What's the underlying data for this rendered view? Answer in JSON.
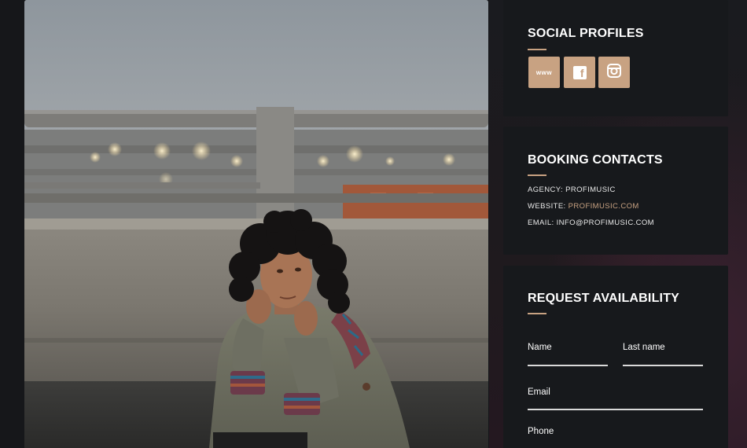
{
  "social": {
    "title": "SOCIAL PROFILES",
    "buttons": [
      {
        "label": "www",
        "icon": "website-icon"
      },
      {
        "label": "f",
        "icon": "facebook-icon"
      },
      {
        "label": "",
        "icon": "instagram-icon"
      }
    ]
  },
  "booking": {
    "title": "BOOKING CONTACTS",
    "agency_label": "AGENCY:",
    "agency_value": "PROFIMUSIC",
    "website_label": "WEBSITE:",
    "website_value": "PROFIMUSIC.COM",
    "email_label": "EMAIL:",
    "email_value": "INFO@PROFIMUSIC.COM"
  },
  "request": {
    "title": "REQUEST AVAILABILITY",
    "name_label": "Name",
    "last_name_label": "Last name",
    "email_label": "Email",
    "phone_label": "Phone"
  },
  "colors": {
    "accent": "#c8a282",
    "panel": "#17191c",
    "background": "#14161a"
  }
}
